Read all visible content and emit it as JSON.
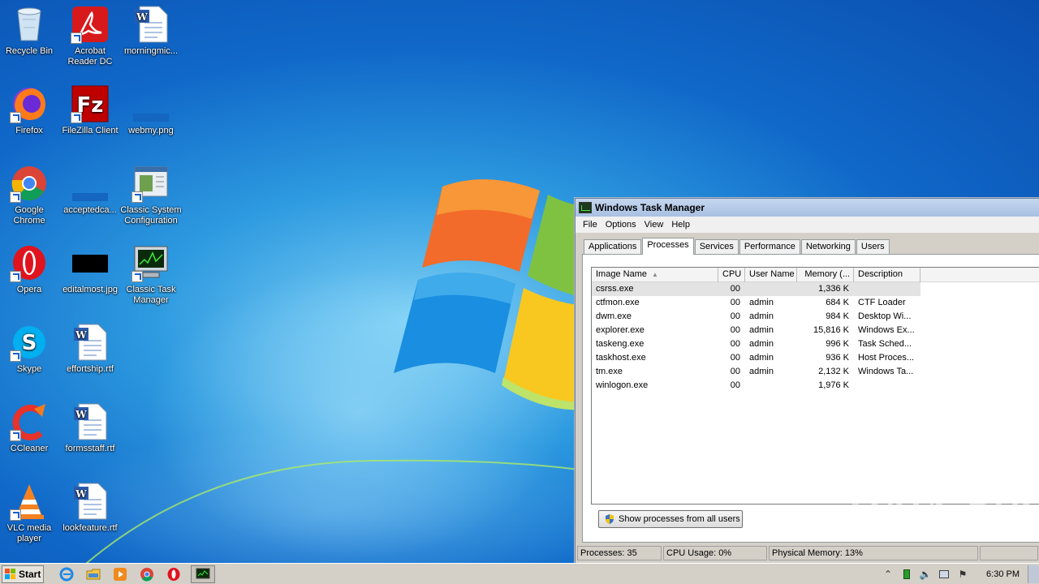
{
  "desktop": {
    "icons": [
      {
        "label": "Recycle Bin",
        "icon": "recycle-bin-icon"
      },
      {
        "label": "Acrobat Reader DC",
        "icon": "acrobat-reader-icon"
      },
      {
        "label": "morningmic...",
        "icon": "word-document-icon"
      },
      {
        "label": "Firefox",
        "icon": "firefox-icon"
      },
      {
        "label": "FileZilla Client",
        "icon": "filezilla-icon"
      },
      {
        "label": "webmy.png",
        "icon": "image-file-icon"
      },
      {
        "label": "Google Chrome",
        "icon": "chrome-icon"
      },
      {
        "label": "acceptedca...",
        "icon": "image-file-icon"
      },
      {
        "label": "Classic System Configuration",
        "icon": "system-config-icon"
      },
      {
        "label": "Opera",
        "icon": "opera-icon"
      },
      {
        "label": "editalmost.jpg",
        "icon": "image-file-icon"
      },
      {
        "label": "Classic Task Manager",
        "icon": "task-manager-icon"
      },
      {
        "label": "Skype",
        "icon": "skype-icon"
      },
      {
        "label": "effortship.rtf",
        "icon": "word-document-icon"
      },
      {
        "label": "CCleaner",
        "icon": "ccleaner-icon"
      },
      {
        "label": "formsstaff.rtf",
        "icon": "word-document-icon"
      },
      {
        "label": "VLC media player",
        "icon": "vlc-icon"
      },
      {
        "label": "lookfeature.rtf",
        "icon": "word-document-icon"
      }
    ]
  },
  "task_manager": {
    "title": "Windows Task Manager",
    "menu": [
      "File",
      "Options",
      "View",
      "Help"
    ],
    "tabs": [
      "Applications",
      "Processes",
      "Services",
      "Performance",
      "Networking",
      "Users"
    ],
    "active_tab": "Processes",
    "columns": [
      "Image Name",
      "CPU",
      "User Name",
      "Memory (...",
      "Description"
    ],
    "processes": [
      {
        "name": "csrss.exe",
        "cpu": "00",
        "user": "",
        "memory": "1,336 K",
        "description": ""
      },
      {
        "name": "ctfmon.exe",
        "cpu": "00",
        "user": "admin",
        "memory": "684 K",
        "description": "CTF Loader"
      },
      {
        "name": "dwm.exe",
        "cpu": "00",
        "user": "admin",
        "memory": "984 K",
        "description": "Desktop Wi..."
      },
      {
        "name": "explorer.exe",
        "cpu": "00",
        "user": "admin",
        "memory": "15,816 K",
        "description": "Windows Ex..."
      },
      {
        "name": "taskeng.exe",
        "cpu": "00",
        "user": "admin",
        "memory": "996 K",
        "description": "Task Sched..."
      },
      {
        "name": "taskhost.exe",
        "cpu": "00",
        "user": "admin",
        "memory": "936 K",
        "description": "Host Proces..."
      },
      {
        "name": "tm.exe",
        "cpu": "00",
        "user": "admin",
        "memory": "2,132 K",
        "description": "Windows Ta..."
      },
      {
        "name": "winlogon.exe",
        "cpu": "00",
        "user": "",
        "memory": "1,976 K",
        "description": ""
      }
    ],
    "show_all_button": "Show processes from all users",
    "status": {
      "processes": "Processes: 35",
      "cpu_usage": "CPU Usage: 0%",
      "physical_memory": "Physical Memory: 13%"
    }
  },
  "watermark": {
    "left": "ANY",
    "right": "RUN"
  },
  "taskbar": {
    "start_label": "Start",
    "pinned": [
      "internet-explorer-icon",
      "explorer-folder-icon",
      "media-player-icon",
      "chrome-icon",
      "opera-icon",
      "task-manager-icon"
    ],
    "clock": "6:30 PM"
  }
}
